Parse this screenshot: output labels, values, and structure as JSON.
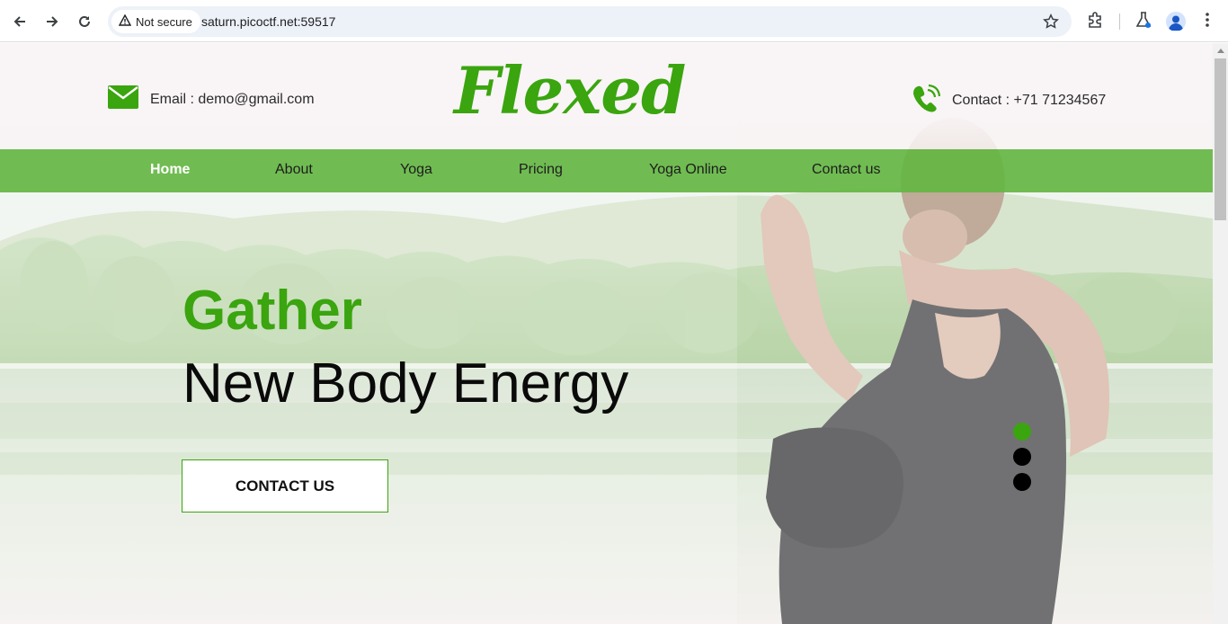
{
  "browser": {
    "security_label": "Not secure",
    "url": "saturn.picoctf.net:59517",
    "icons": [
      "back-arrow-icon",
      "forward-arrow-icon",
      "reload-icon",
      "warning-triangle-icon",
      "star-icon",
      "extensions-icon",
      "labs-flask-icon",
      "profile-icon",
      "more-vert-icon"
    ]
  },
  "header": {
    "email_label": "Email : demo@gmail.com",
    "logo": "Flexed",
    "contact_label": "Contact : +71 71234567"
  },
  "nav": {
    "items": [
      {
        "label": "Home",
        "active": true
      },
      {
        "label": "About",
        "active": false
      },
      {
        "label": "Yoga",
        "active": false
      },
      {
        "label": "Pricing",
        "active": false
      },
      {
        "label": "Yoga Online",
        "active": false
      },
      {
        "label": "Contact us",
        "active": false
      }
    ]
  },
  "hero": {
    "title": "Gather",
    "subtitle": "New Body Energy",
    "button_label": "CONTACT US"
  },
  "carousel": {
    "slide_count": 3,
    "active_index": 0
  },
  "colors": {
    "brand_green": "#3aa50f",
    "nav_green": "#62b640",
    "text_dark": "#0a0a0a"
  }
}
